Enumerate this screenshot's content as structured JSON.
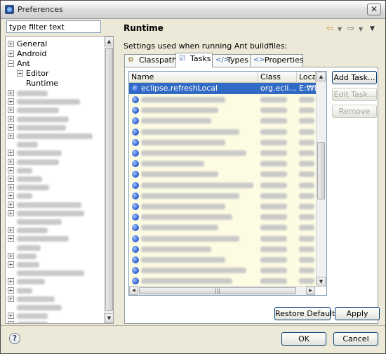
{
  "window": {
    "title": "Preferences",
    "close_label": "✕"
  },
  "filter": {
    "value": "type filter text"
  },
  "tree": {
    "items": [
      {
        "label": "General",
        "expander": "+",
        "indent": 0
      },
      {
        "label": "Android",
        "expander": "+",
        "indent": 0
      },
      {
        "label": "Ant",
        "expander": "−",
        "indent": 0
      },
      {
        "label": "Editor",
        "expander": "+",
        "indent": 1
      },
      {
        "label": "Runtime",
        "expander": "",
        "indent": 1
      }
    ],
    "blurred_count": 28
  },
  "page": {
    "title": "Runtime",
    "subtitle": "Settings used when running Ant buildfiles:",
    "tabs": [
      {
        "label": "Classpath",
        "active": false
      },
      {
        "label": "Tasks",
        "active": true
      },
      {
        "label": "Types",
        "active": false
      },
      {
        "label": "Properties",
        "active": false
      }
    ]
  },
  "table": {
    "columns": [
      "Name",
      "Class",
      "Locati"
    ],
    "selected_row": {
      "name": "eclipse.refreshLocal",
      "class": "org.ecli...",
      "location": "E:₩D"
    },
    "blurred_rows": 18
  },
  "buttons": {
    "add_task": "Add Task...",
    "edit_task": "Edit Task...",
    "remove": "Remove",
    "restore_defaults": "Restore Defaults",
    "apply": "Apply",
    "ok": "OK",
    "cancel": "Cancel"
  },
  "icons": {
    "help": "help-icon",
    "back": "back-arrow-icon",
    "forward": "forward-arrow-icon",
    "menu": "view-menu-icon"
  }
}
